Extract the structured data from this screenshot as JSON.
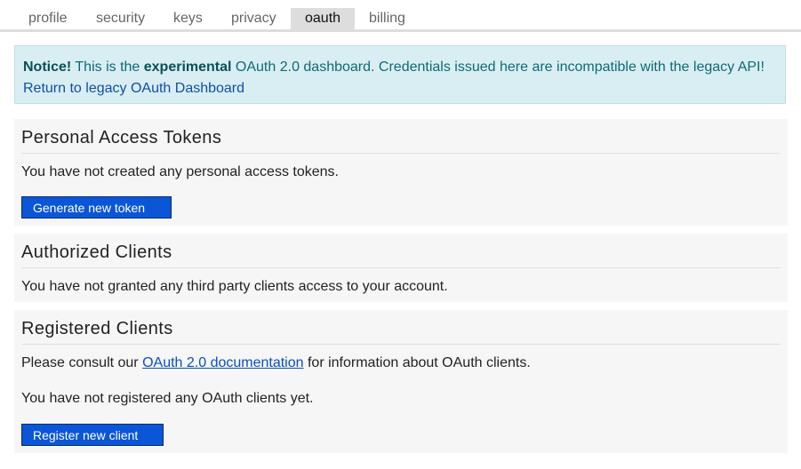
{
  "tabs": [
    {
      "label": "profile"
    },
    {
      "label": "security"
    },
    {
      "label": "keys"
    },
    {
      "label": "privacy"
    },
    {
      "label": "oauth"
    },
    {
      "label": "billing"
    }
  ],
  "notice": {
    "strong": "Notice!",
    "text1": " This is the ",
    "emphasis": "experimental",
    "text2": " OAuth 2.0 dashboard. Credentials issued here are incompatible with the legacy API!",
    "link": "Return to legacy OAuth Dashboard"
  },
  "tokens": {
    "title": "Personal Access Tokens",
    "message": "You have not created any personal access tokens.",
    "button": "Generate new token"
  },
  "authorized": {
    "title": "Authorized Clients",
    "message": "You have not granted any third party clients access to your account."
  },
  "registered": {
    "title": "Registered Clients",
    "consult_prefix": "Please consult our ",
    "consult_link": "OAuth 2.0 documentation",
    "consult_suffix": " for information about OAuth clients.",
    "message": "You have not registered any OAuth clients yet.",
    "button": "Register new client"
  },
  "colors": {
    "primary_button": "#0a56d6",
    "notice_bg": "#d9eef3",
    "active_tab": "#dddddd"
  }
}
